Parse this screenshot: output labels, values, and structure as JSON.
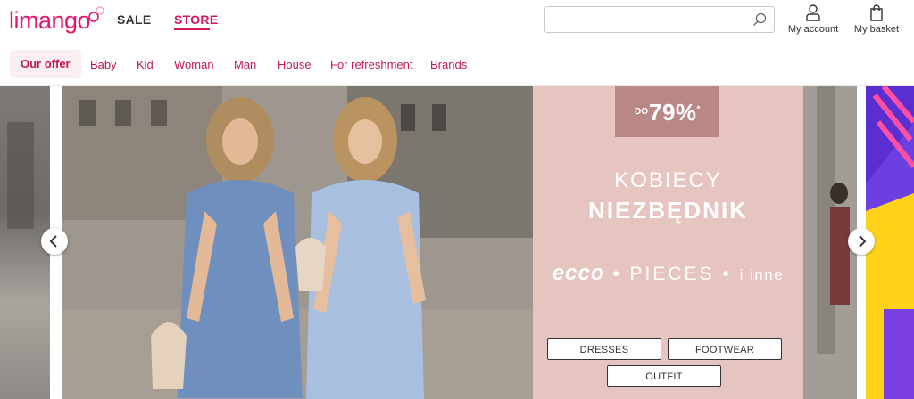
{
  "header": {
    "logo_text": "limango",
    "tabs": [
      {
        "label": "SALE",
        "active": false
      },
      {
        "label": "STORE",
        "active": true
      }
    ],
    "search": {
      "value": "",
      "placeholder": ""
    },
    "account_label": "My account",
    "basket_label": "My basket"
  },
  "nav": {
    "items": [
      "Our offer",
      "Baby",
      "Kid",
      "Woman",
      "Man",
      "House",
      "For refreshment",
      "Brands"
    ],
    "active_index": 0
  },
  "promo": {
    "badge_prefix": "DO",
    "badge_value": "79%",
    "badge_mark": "*",
    "title_line1": "KOBIECY",
    "title_line2": "NIEZBĘDNIK",
    "brand1": "ecco",
    "brand2": "• PIECES •",
    "brand3": "i inne",
    "buttons": [
      "DRESSES",
      "FOOTWEAR",
      "OUTFIT"
    ]
  },
  "carousel": {
    "prev_icon": "chevron-left-icon",
    "next_icon": "chevron-right-icon"
  },
  "colors": {
    "brand": "#e3176f",
    "nav_text": "#c2185b",
    "promo_bg": "#e6c4bf",
    "badge_bg": "#b98886"
  }
}
